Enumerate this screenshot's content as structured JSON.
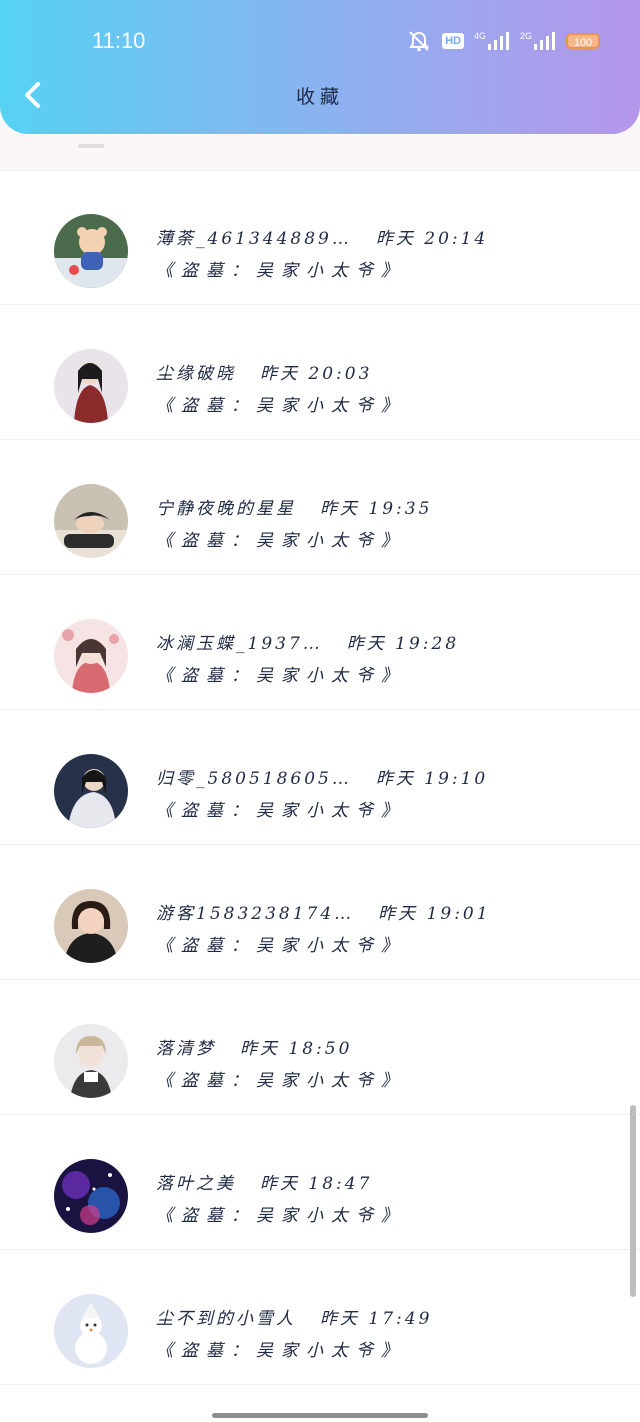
{
  "status_bar": {
    "time": "11:10",
    "network_1": "4G",
    "network_2": "2G",
    "battery": "100",
    "icons": [
      "mute-bell-icon",
      "hd-icon",
      "signal-icon",
      "signal-icon",
      "battery-icon"
    ]
  },
  "header": {
    "title": "收藏",
    "back_icon": "chevron-left-icon"
  },
  "items": [
    {
      "name": "薄荼_461344889…",
      "time": "昨天 20:14",
      "title": "《盗墓：吴家小太爷》",
      "avatar": "cartoon-bear-avatar"
    },
    {
      "name": "尘缘破晓",
      "time": "昨天 20:03",
      "title": "《盗墓：吴家小太爷》",
      "avatar": "portrait-avatar"
    },
    {
      "name": "宁静夜晚的星星",
      "time": "昨天 19:35",
      "title": "《盗墓：吴家小太爷》",
      "avatar": "portrait-avatar"
    },
    {
      "name": "冰澜玉蝶_1937…",
      "time": "昨天 19:28",
      "title": "《盗墓：吴家小太爷》",
      "avatar": "anime-avatar"
    },
    {
      "name": "归零_580518605…",
      "time": "昨天 19:10",
      "title": "《盗墓：吴家小太爷》",
      "avatar": "portrait-avatar"
    },
    {
      "name": "游客1583238174…",
      "time": "昨天 19:01",
      "title": "《盗墓：吴家小太爷》",
      "avatar": "portrait-avatar"
    },
    {
      "name": "落清梦",
      "time": "昨天 18:50",
      "title": "《盗墓：吴家小太爷》",
      "avatar": "anime-avatar"
    },
    {
      "name": "落叶之美",
      "time": "昨天 18:47",
      "title": "《盗墓：吴家小太爷》",
      "avatar": "galaxy-avatar"
    },
    {
      "name": "尘不到的小雪人",
      "time": "昨天 17:49",
      "title": "《盗墓：吴家小太爷》",
      "avatar": "snowman-avatar"
    }
  ],
  "colors": {
    "header_start": "#56d2f3",
    "header_end": "#b596ea",
    "text": "#1f2a44"
  }
}
